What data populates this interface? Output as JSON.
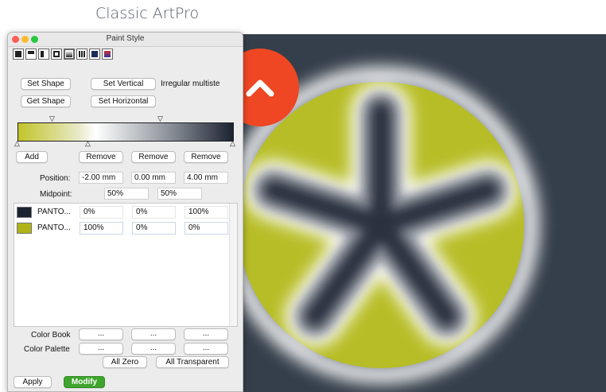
{
  "caption": "Classic ArtPro",
  "window": {
    "title": "Paint Style"
  },
  "toolbar": {
    "icons": [
      "fill-solid-icon",
      "fill-top-icon",
      "fill-left-icon",
      "stroke-icon",
      "gradient-icon",
      "pattern-icon",
      "vignette-icon",
      "image-fill-icon"
    ]
  },
  "buttons": {
    "set_shape": "Set Shape",
    "set_vertical": "Set Vertical",
    "get_shape": "Get Shape",
    "set_horizontal": "Set Horizontal",
    "irregular_label": "Irregular multiste",
    "add": "Add",
    "remove": "Remove",
    "apply": "Apply",
    "modify": "Modify",
    "all_zero": "All Zero",
    "all_transparent": "All Transparent"
  },
  "gradient": {
    "start_color": "#c2c42a",
    "end_color": "#1c2331",
    "top_markers": [
      "▽",
      "▽"
    ],
    "bottom_markers": [
      "△",
      "△",
      "△"
    ]
  },
  "position": {
    "label": "Position:",
    "values": [
      "-2.00 mm",
      "0.00 mm",
      "4.00 mm"
    ]
  },
  "midpoint": {
    "label": "Midpoint:",
    "values": [
      "50%",
      "50%"
    ]
  },
  "inks": [
    {
      "name": "PANTO...",
      "color": "#1b2331",
      "values": [
        "0%",
        "0%",
        "100%"
      ]
    },
    {
      "name": "PANTO...",
      "color": "#afb318",
      "values": [
        "100%",
        "0%",
        "0%"
      ]
    }
  ],
  "color_book": {
    "label": "Color Book",
    "values": [
      "...",
      "...",
      "..."
    ]
  },
  "color_palette": {
    "label": "Color Palette",
    "values": [
      "...",
      "...",
      "..."
    ]
  },
  "colors": {
    "accent_green": "#3fa52d",
    "badge_orange": "#ef4723",
    "canvas_bg": "#353f4b",
    "artwork_green": "#b7bd26"
  }
}
